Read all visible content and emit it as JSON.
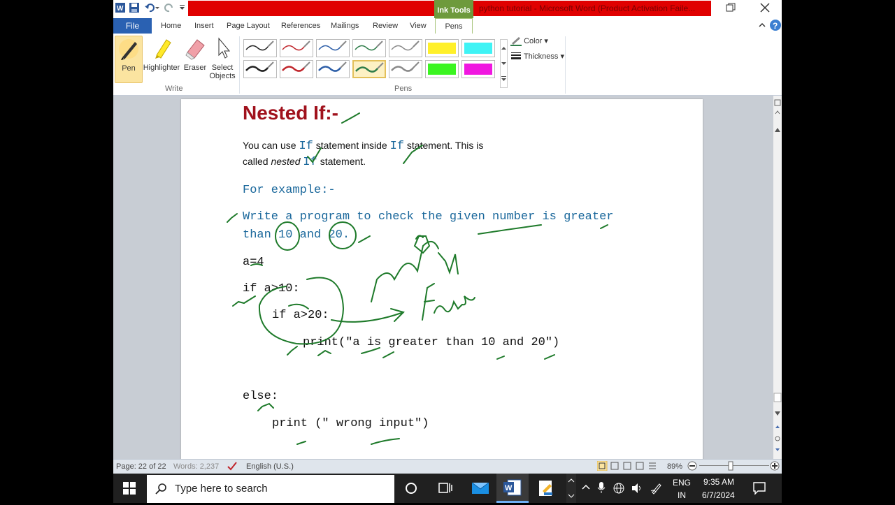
{
  "title_bar": {
    "ink_tools_label": "Ink Tools",
    "document_title": "python tutorial - Microsoft Word (Product Activation Faile..."
  },
  "tabs": [
    "File",
    "Home",
    "Insert",
    "Page Layout",
    "References",
    "Mailings",
    "Review",
    "View",
    "Pens"
  ],
  "ribbon": {
    "buttons": {
      "pen": "Pen",
      "highlighter": "Highlighter",
      "eraser": "Eraser",
      "select_line1": "Select",
      "select_line2": "Objects"
    },
    "group_write": "Write",
    "group_pens": "Pens",
    "color_label": "Color",
    "thickness_label": "Thickness",
    "colors": {
      "black": "#222222",
      "red": "#c0262c",
      "blue": "#2e5fa8",
      "green": "#2f7d4a",
      "gray": "#8a8a8a",
      "yellow": "#fff02a",
      "cyan": "#3ff3f5",
      "lime": "#3bf521",
      "magenta": "#f017e0"
    }
  },
  "document": {
    "heading": "Nested If:-",
    "para_line1_a": "You can use ",
    "kw_if": "If",
    "para_line1_b": " statement inside ",
    "para_line1_c": " statement. This is",
    "para_line2_a": "called ",
    "para_line2_italic": "nested",
    "para_line2_b": " statement.",
    "example_heading": "For example:-",
    "task_line1": "Write a program to check the given number is greater",
    "task_line2_a": "than ",
    "task_10": "10",
    "task_and": " and ",
    "task_20": "20.",
    "code_a": "a=4",
    "code_if1": "if a>10:",
    "code_if2": "if a>20:",
    "code_print1": "print(\"a is greater than 10 and 20\")",
    "code_else": "else:",
    "code_print2": "print (\" wrong input\")"
  },
  "status_bar": {
    "page": "Page: 22 of 22",
    "words": "Words: 2,237",
    "language": "English (U.S.)",
    "zoom": "89%"
  },
  "taskbar": {
    "search_placeholder": "Type here to search",
    "lang_top": "ENG",
    "lang_bottom": "IN",
    "time": "9:35 AM",
    "date": "6/7/2024"
  }
}
